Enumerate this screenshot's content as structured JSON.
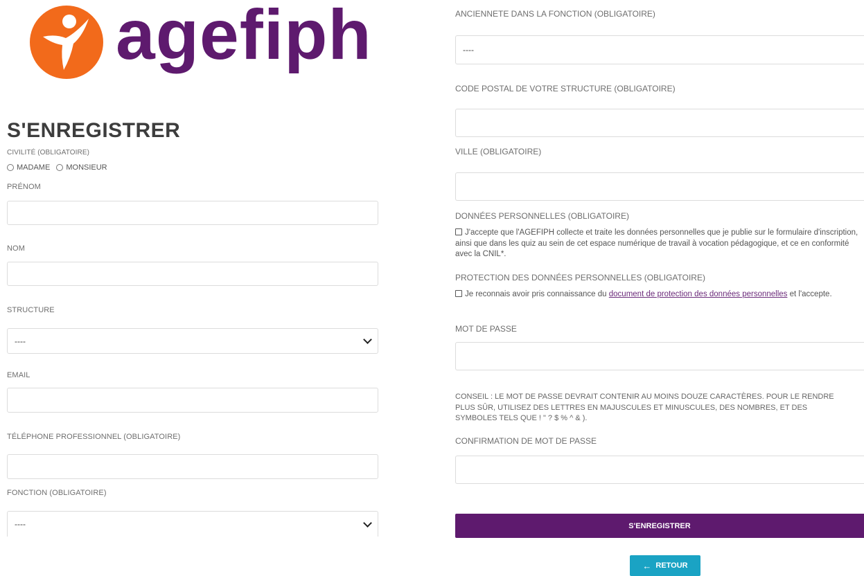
{
  "brand": {
    "name": "agefiph",
    "logo_color": "#f26a1b",
    "text_color": "#5e1a6e"
  },
  "page": {
    "title": "S'ENREGISTRER"
  },
  "form_left": {
    "civilite_label": "CIVILITÉ (OBLIGATOIRE)",
    "civilite_options": [
      "MADAME",
      "MONSIEUR"
    ],
    "prenom_label": "PRÉNOM",
    "nom_label": "NOM",
    "structure_label": "STRUCTURE",
    "structure_value": "----",
    "email_label": "EMAIL",
    "telephone_label": "TÉLÉPHONE PROFESSIONNEL (OBLIGATOIRE)",
    "fonction_label": "FONCTION (OBLIGATOIRE)",
    "fonction_value": "----"
  },
  "form_right": {
    "anciennete_label": "ANCIENNETE DANS LA FONCTION (OBLIGATOIRE)",
    "anciennete_value": "----",
    "code_postal_label": "CODE POSTAL DE VOTRE STRUCTURE (OBLIGATOIRE)",
    "ville_label": "VILLE (OBLIGATOIRE)",
    "donnees_label": "DONNÉES PERSONNELLES (OBLIGATOIRE)",
    "donnees_text": "J'accepte que l'AGEFIPH collecte et traite les données personnelles que je publie sur le formulaire d'inscription, ainsi que dans les quiz au sein de cet espace numérique de travail à vocation pédagogique, et ce en conformité avec la CNIL*.",
    "protection_label": "PROTECTION DES DONNÉES PERSONNELLES (OBLIGATOIRE)",
    "protection_text_before": "Je reconnais avoir pris connaissance du",
    "protection_link": "document de protection des données personnelles",
    "protection_text_after": "et l'accepte.",
    "password_label": "MOT DE PASSE",
    "password_hint": "CONSEIL : LE MOT DE PASSE DEVRAIT CONTENIR AU MOINS DOUZE CARACTÈRES. POUR LE RENDRE PLUS SÛR, UTILISEZ DES LETTRES EN MAJUSCULES ET MINUSCULES, DES NOMBRES, ET DES SYMBOLES TELS QUE ! \" ? $ % ^ & ).",
    "confirm_label": "CONFIRMATION DE MOT DE PASSE",
    "submit_label": "S'ENREGISTRER",
    "back_arrow": "←",
    "back_label": "RETOUR"
  },
  "colors": {
    "primary": "#5e1a6e",
    "back_button": "#1aa3c4"
  }
}
